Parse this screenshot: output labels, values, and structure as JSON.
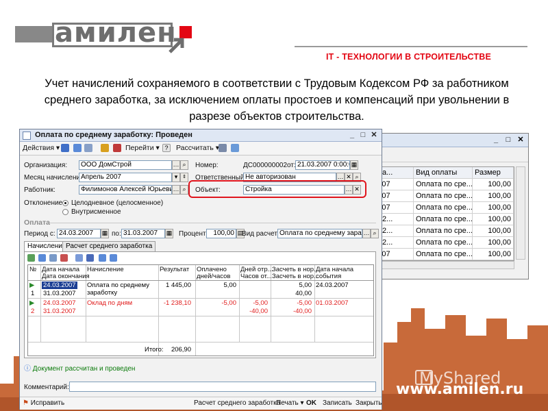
{
  "slide": {
    "logo_text": "амилен",
    "tagline": "IT - ТЕХНОЛОГИИ В СТРОИТЕЛЬСТВЕ",
    "description": "Учет начислений сохраняемого в соответствии с Трудовым Кодексом РФ за работником среднего заработка, за исключением оплаты простоев и компенсаций при увольнении в разрезе объектов строительства.",
    "website": "www.amilen.ru",
    "watermark": "MyShared",
    "brand_red": "#e30613"
  },
  "back_window": {
    "columns": [
      "есяц на...",
      "Вид оплаты",
      "Размер"
    ],
    "rows": [
      [
        "арт 2007",
        "Оплата по сре...",
        "100,00"
      ],
      [
        "арт 2007",
        "Оплата по сре...",
        "100,00"
      ],
      [
        "арт 2007",
        "Оплата по сре...",
        "100,00"
      ],
      [
        "прель 2...",
        "Оплата по сре...",
        "100,00"
      ],
      [
        "прель 2...",
        "Оплата по сре...",
        "100,00"
      ],
      [
        "прель 2...",
        "Оплата по сре...",
        "100,00"
      ],
      [
        "арт 2007",
        "Оплата по сре...",
        "100,00"
      ]
    ]
  },
  "window": {
    "title": "Оплата по среднему заработку: Проведен",
    "toolbar": {
      "actions": "Действия",
      "goto": "Перейти",
      "calculate": "Рассчитать",
      "help": "?"
    },
    "form": {
      "org_label": "Организация:",
      "org_value": "ООО ДомСтрой",
      "month_label": "Месяц начисления:",
      "month_value": "Апрель 2007",
      "worker_label": "Работник:",
      "worker_value": "Филимонов Алексей Юрьевич",
      "deviation_label": "Отклонение:",
      "radio_whole": "Целодневное (целосменное)",
      "radio_intra": "Внутрисменное",
      "number_label": "Номер:",
      "number_value": "ДС000000002",
      "from_label": "от:",
      "date_value": "21.03.2007 0:00:00",
      "resp_label": "Ответственный:",
      "resp_value": "Не авторизован",
      "object_label": "Объект:",
      "object_value": "Стройка"
    },
    "payment": {
      "section": "Оплата",
      "period_from_label": "Период с:",
      "period_from": "24.03.2007",
      "period_to_label": "по:",
      "period_to": "31.03.2007",
      "percent_label": "Процент:",
      "percent_value": "100,00",
      "calc_type_label": "Вид расчета:",
      "calc_type_value": "Оплата по среднему заработку"
    },
    "tabs": [
      "Начисления",
      "Расчет среднего заработка"
    ],
    "grid": {
      "headers": {
        "num": "№",
        "date_start": "Дата начала",
        "date_end": "Дата окончания",
        "accrual": "Начисление",
        "result": "Результат",
        "paid": "Оплачено",
        "paid2": "дней/часов",
        "days": "Дней отр...",
        "hours": "Часов от...",
        "norm1": "Засчеть в нор...",
        "norm2": "Засчеть в нор...",
        "event1": "Дата начала",
        "event2": "события"
      },
      "rows": [
        {
          "num": "1",
          "date_start": "24.03.2007",
          "date_end": "31.03.2007",
          "accrual": "Оплата по среднему заработку",
          "result": "1 445,00",
          "paid": "5,00",
          "days": "",
          "hours": "",
          "norm_days": "5,00",
          "norm_hours": "40,00",
          "event_date": "24.03.2007",
          "red": false
        },
        {
          "num": "2",
          "date_start": "24.03.2007",
          "date_end": "31.03.2007",
          "accrual": "Оклад по дням",
          "result": "-1 238,10",
          "paid": "-5,00",
          "days": "-5,00",
          "hours": "-40,00",
          "norm_days": "-5,00",
          "norm_hours": "-40,00",
          "event_date": "01.03.2007",
          "red": true
        }
      ],
      "total_label": "Итого:",
      "total_value": "206,90"
    },
    "status_text": "Документ рассчитан и проведен",
    "comment_label": "Комментарий:",
    "comment_value": "",
    "bottom": {
      "fix": "Исправить",
      "avg_calc": "Расчет среднего заработка",
      "print": "Печать",
      "ok": "OK",
      "save": "Записать",
      "close": "Закрыть"
    }
  }
}
